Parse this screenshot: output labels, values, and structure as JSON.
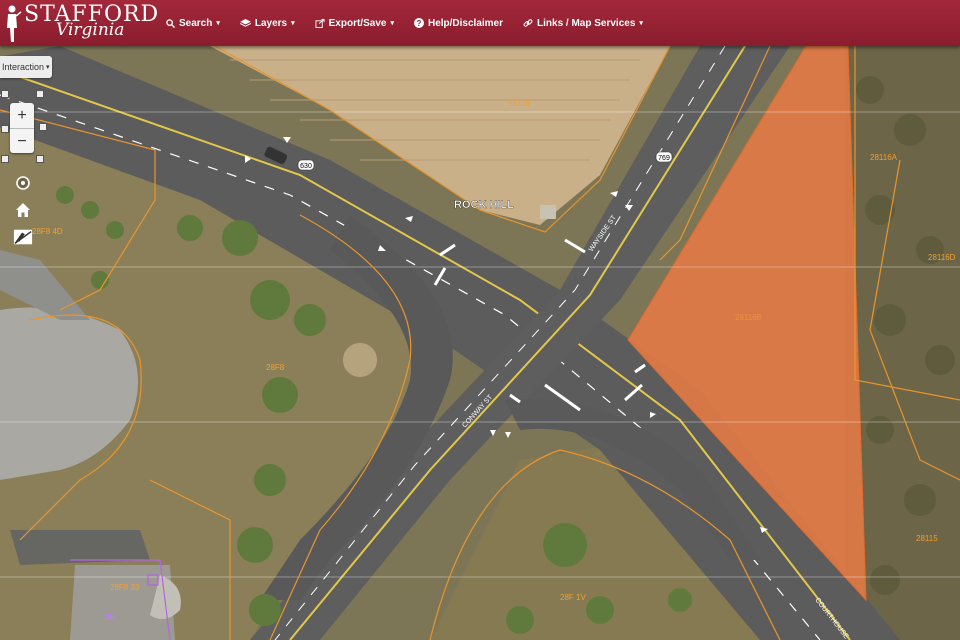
{
  "header": {
    "logo_title": "STAFFORD",
    "logo_subtitle": "Virginia",
    "brand_color": "#9a2235"
  },
  "nav": {
    "items": [
      {
        "label": "Search",
        "icon": "search-icon"
      },
      {
        "label": "Layers",
        "icon": "layers-icon"
      },
      {
        "label": "Export/Save",
        "icon": "export-icon"
      },
      {
        "label": "Help/Disclaimer",
        "icon": "help-icon"
      },
      {
        "label": "Links / Map Services",
        "icon": "link-icon"
      }
    ]
  },
  "map_controls": {
    "interaction_label": "Interaction",
    "zoom_in": "+",
    "zoom_out": "−"
  },
  "map": {
    "place_label": "ROCK HILL",
    "route_shields": [
      "630",
      "769"
    ],
    "street_labels": [
      "WAYSIDE ST",
      "CONWAY ST",
      "COURTHOUSE"
    ],
    "parcels": [
      "28116",
      "28116A",
      "28116D",
      "28116B",
      "28F8 4D",
      "28F8",
      "28F8 33",
      "28F 1V",
      "28115",
      "2K"
    ],
    "highlight_color": "#e07a45"
  }
}
